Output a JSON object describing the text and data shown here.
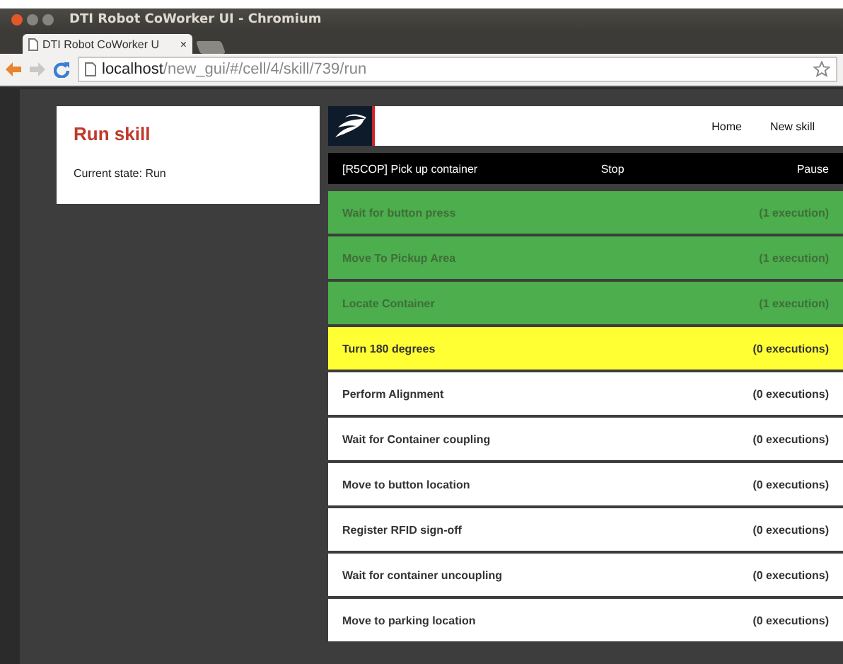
{
  "window": {
    "title": "DTI Robot CoWorker UI - Chromium"
  },
  "tabs": [
    {
      "label": "DTI Robot CoWorker U",
      "close": "×",
      "selected": true
    }
  ],
  "address_bar": {
    "host": "localhost",
    "path": "/new_gui/#/cell/4/skill/739/run"
  },
  "side_panel": {
    "title": "Run skill",
    "state": "Current state: Run"
  },
  "nav": [
    {
      "label": "Home"
    },
    {
      "label": "New skill"
    }
  ],
  "skill_bar": {
    "name": "[R5COP] Pick up container",
    "stop": "Stop",
    "pause": "Pause"
  },
  "steps": [
    {
      "name": "Wait for button press",
      "count": "(1 execution)",
      "color": "#4cae4c"
    },
    {
      "name": "Move To Pickup Area",
      "count": "(1 execution)",
      "color": "#4cae4c"
    },
    {
      "name": "Locate Container",
      "count": "(1 execution)",
      "color": "#4cae4c"
    },
    {
      "name": "Turn 180 degrees",
      "count": "(0 executions)",
      "color": "#ffff33"
    },
    {
      "name": "Perform Alignment",
      "count": "(0 executions)",
      "color": "#ffffff"
    },
    {
      "name": "Wait for Container coupling",
      "count": "(0 executions)",
      "color": "#ffffff"
    },
    {
      "name": "Move to button location",
      "count": "(0 executions)",
      "color": "#ffffff"
    },
    {
      "name": "Register RFID sign-off",
      "count": "(0 executions)",
      "color": "#ffffff"
    },
    {
      "name": "Wait for container uncoupling",
      "count": "(0 executions)",
      "color": "#ffffff"
    },
    {
      "name": "Move to parking location",
      "count": "(0 executions)",
      "color": "#ffffff"
    }
  ]
}
